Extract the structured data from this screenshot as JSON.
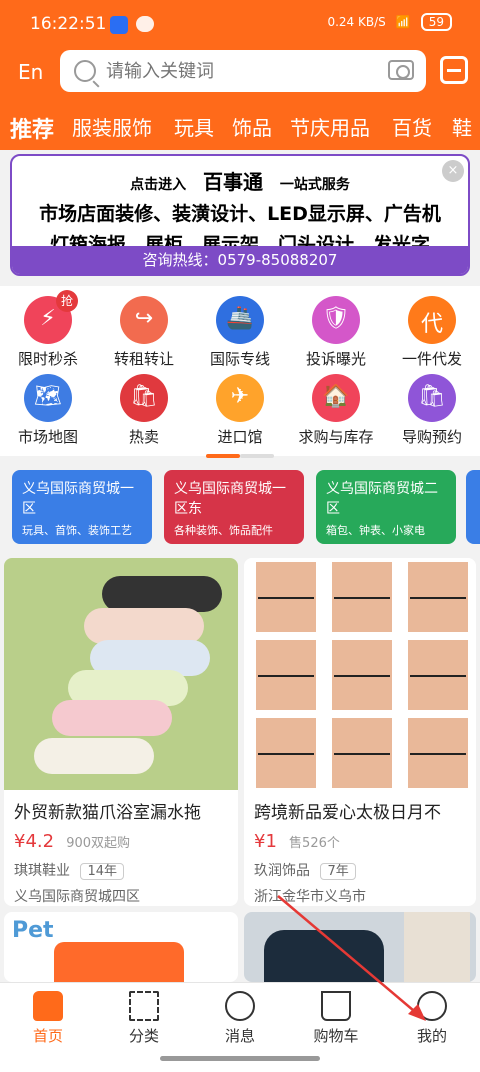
{
  "status": {
    "time": "16:22:51",
    "net": "0.24 KB/S",
    "battery": "59"
  },
  "header": {
    "lang": "En",
    "search_placeholder": "请输入关键词"
  },
  "categories": [
    "推荐",
    "服装服饰",
    "玩具",
    "饰品",
    "节庆用品",
    "百货",
    "鞋"
  ],
  "banner": {
    "prefix": "点击进入",
    "logo": "百事通",
    "suffix": "一站式服务",
    "line1": "市场店面装修、装潢设计、LED显示屏、广告机",
    "line2": "灯箱海报、展柜、展示架、门头设计、发光字",
    "hotline": "咨询热线：0579-85088207",
    "close": "×"
  },
  "icon_grid": [
    {
      "label": "限时秒杀",
      "glyph": "⚡",
      "color": "#f0445a",
      "badge": "抢"
    },
    {
      "label": "转租转让",
      "glyph": "↪",
      "color": "#f26b4f"
    },
    {
      "label": "国际专线",
      "glyph": "🚢",
      "color": "#2f6fe0"
    },
    {
      "label": "投诉曝光",
      "glyph": "🛡",
      "color": "#d457c9"
    },
    {
      "label": "一件代发",
      "glyph": "代",
      "color": "#ff7a1a"
    },
    {
      "label": "市场地图",
      "glyph": "🗺",
      "color": "#3e7ce3"
    },
    {
      "label": "热卖",
      "glyph": "🛍",
      "color": "#e0393e"
    },
    {
      "label": "进口馆",
      "glyph": "✈",
      "color": "#ffa32b"
    },
    {
      "label": "求购与库存",
      "glyph": "🏠",
      "color": "#f0445a"
    },
    {
      "label": "导购预约",
      "glyph": "🛍",
      "color": "#8f55d8"
    }
  ],
  "market_cards": [
    {
      "title": "义乌国际商贸城一区",
      "sub": "玩具、首饰、装饰工艺",
      "color": "#3a7ee6"
    },
    {
      "title": "义乌国际商贸城一区东",
      "sub": "各种装饰、饰品配件",
      "color": "#d63448"
    },
    {
      "title": "义乌国际商贸城二区",
      "sub": "箱包、钟表、小家电",
      "color": "#27a95a"
    }
  ],
  "products": [
    {
      "title": "外贸新款猫爪浴室漏水拖",
      "price_symbol": "¥",
      "price": "4.2",
      "min_order": "900双起购",
      "shop": "琪琪鞋业",
      "years": "14年",
      "location": "义乌国际商贸城四区"
    },
    {
      "title": "跨境新品爱心太极日月不",
      "price_symbol": "¥",
      "price": "1",
      "min_order": "售526个",
      "shop": "玖润饰品",
      "years": "7年",
      "location": "浙江金华市义乌市"
    }
  ],
  "bottom_nav": [
    "首页",
    "分类",
    "消息",
    "购物车",
    "我的"
  ],
  "colors": {
    "brand": "#ff6a1a",
    "banner_purple": "#7d4bc6",
    "price": "#e4393c"
  }
}
